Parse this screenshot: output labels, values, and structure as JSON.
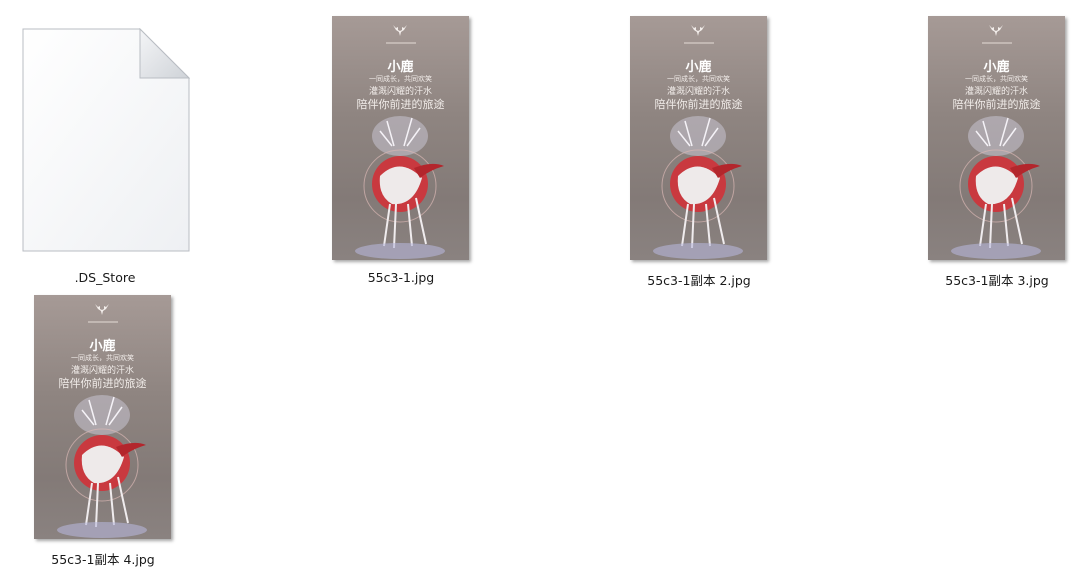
{
  "files": [
    {
      "name": ".DS_Store",
      "type": "generic"
    },
    {
      "name": "55c3-1.jpg",
      "type": "image"
    },
    {
      "name": "55c3-1副本 2.jpg",
      "type": "image"
    },
    {
      "name": "55c3-1副本 3.jpg",
      "type": "image"
    },
    {
      "name": "55c3-1副本 4.jpg",
      "type": "image"
    }
  ],
  "poster": {
    "title": "小鹿",
    "line1": "一同成长，共同欢笑",
    "line2": "灌溉闪耀的汗水",
    "line3": "陪伴你前进的旅途"
  },
  "colors": {
    "poster_bg": "#8f8581",
    "accent_red": "#b3262c"
  },
  "icons": [
    "document-icon",
    "deer-logo-icon"
  ]
}
